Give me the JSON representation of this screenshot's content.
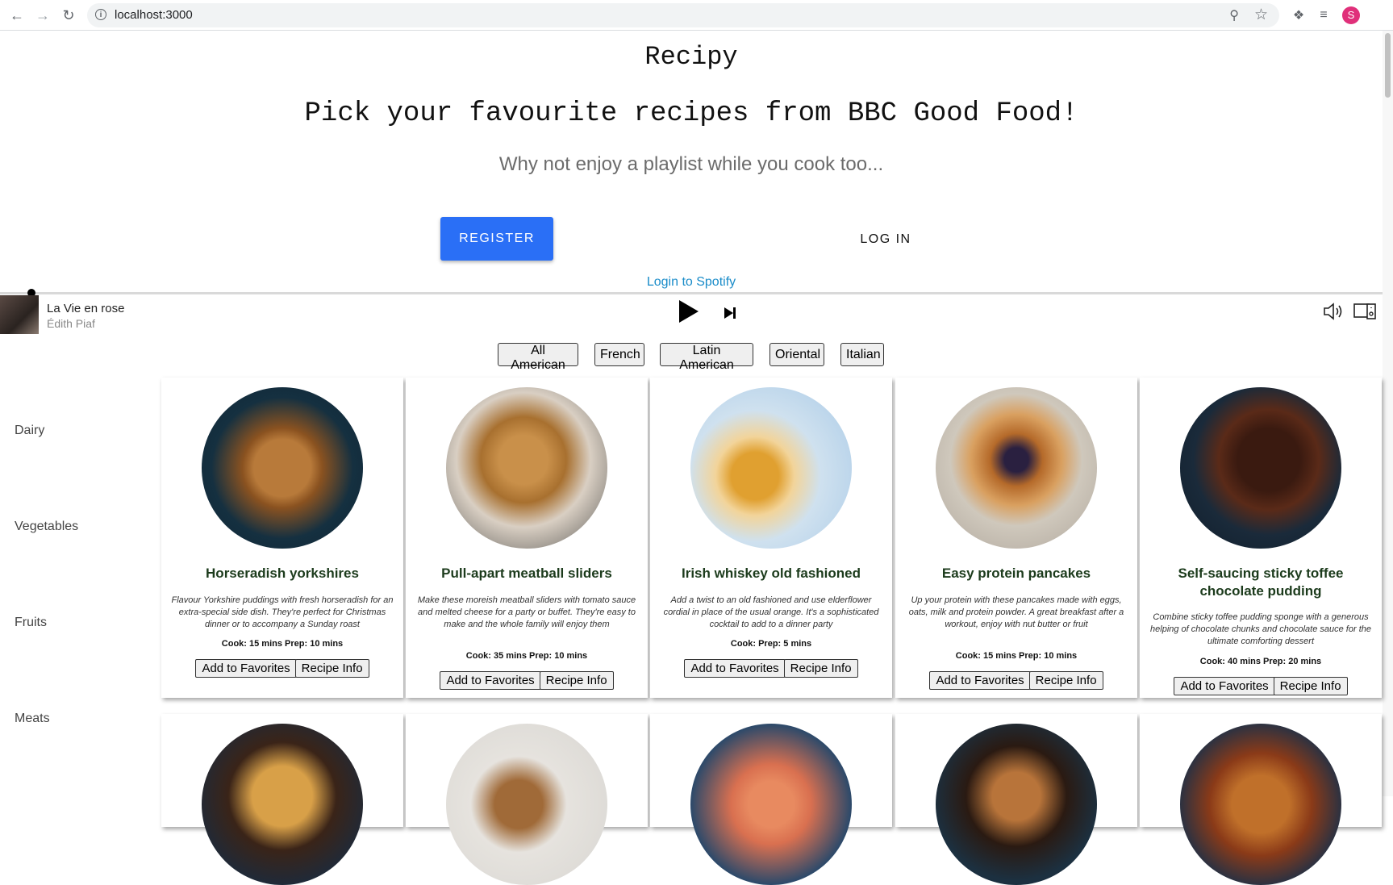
{
  "browser": {
    "url": "localhost:3000",
    "avatar_letter": "S"
  },
  "header": {
    "title": "Recipy",
    "headline": "Pick your favourite recipes from BBC Good Food!",
    "subline": "Why not enjoy a playlist while you cook too...",
    "register_label": "REGISTER",
    "login_label": "LOG IN",
    "spotify_link": "Login to Spotify"
  },
  "player": {
    "track": "La Vie en rose",
    "artist": "Édith Piaf",
    "progress": 0.02
  },
  "cuisines": [
    "All American",
    "French",
    "Latin American",
    "Oriental",
    "Italian"
  ],
  "sidebar": [
    "Dairy",
    "Vegetables",
    "Fruits",
    "Meats"
  ],
  "recipes": [
    {
      "title": "Horseradish yorkshires",
      "desc": "Flavour Yorkshire puddings with fresh horseradish for an extra-special side dish. They're perfect for Christmas dinner or to accompany a Sunday roast",
      "meta": "Cook: 15 mins Prep: 10 mins"
    },
    {
      "title": "Pull-apart meatball sliders",
      "desc": "Make these moreish meatball sliders with tomato sauce and melted cheese for a party or buffet. They're easy to make and the whole family will enjoy them",
      "meta": "Cook: 35 mins Prep: 10 mins"
    },
    {
      "title": "Irish whiskey old fashioned",
      "desc": "Add a twist to an old fashioned and use elderflower cordial in place of the usual orange. It's a sophisticated cocktail to add to a dinner party",
      "meta": "Cook: Prep: 5 mins"
    },
    {
      "title": "Easy protein pancakes",
      "desc": "Up your protein with these pancakes made with eggs, oats, milk and protein powder. A great breakfast after a workout, enjoy with nut butter or fruit",
      "meta": "Cook: 15 mins Prep: 10 mins"
    },
    {
      "title": "Self-saucing sticky toffee chocolate pudding",
      "desc": "Combine sticky toffee pudding sponge with a generous helping of chocolate chunks and chocolate sauce for the ultimate comforting dessert",
      "meta": "Cook: 40 mins Prep: 20 mins"
    }
  ],
  "actions": {
    "favorite_label": "Add to Favorites",
    "info_label": "Recipe Info"
  }
}
